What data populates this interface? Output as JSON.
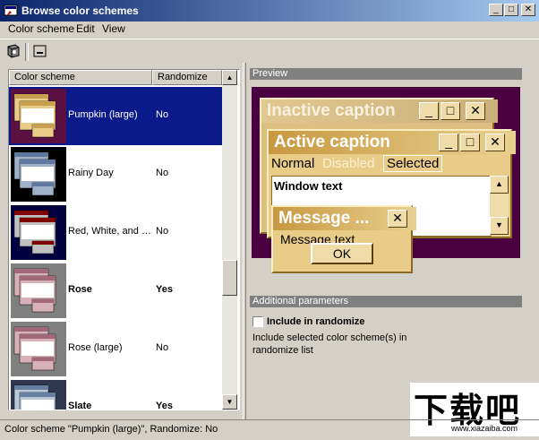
{
  "window": {
    "title": "Browse color schemes",
    "minimize": "_",
    "maximize": "□",
    "close": "✕"
  },
  "menu": [
    "Color scheme",
    "Edit",
    "View"
  ],
  "toolbar": {
    "button1": "color-scheme-icon",
    "button2": "minimize-window-icon"
  },
  "list": {
    "headers": {
      "name": "Color scheme",
      "randomize": "Randomize"
    },
    "rows": [
      {
        "name": "Pumpkin (large)",
        "randomize": "No",
        "selected": true,
        "bold": false,
        "bg": "#5a1040",
        "win": "#e8cc88",
        "cap": "#c8a050"
      },
      {
        "name": "Rainy Day",
        "randomize": "No",
        "selected": false,
        "bold": false,
        "bg": "#000000",
        "win": "#a0b0c8",
        "cap": "#6078a0"
      },
      {
        "name": "Red, White, and Blue (VGA)",
        "randomize": "No",
        "selected": false,
        "bold": false,
        "bg": "#000040",
        "win": "#c0c0c0",
        "cap": "#800000"
      },
      {
        "name": "Rose",
        "randomize": "Yes",
        "selected": false,
        "bold": true,
        "bg": "#808080",
        "win": "#d8b0b8",
        "cap": "#a06878"
      },
      {
        "name": "Rose (large)",
        "randomize": "No",
        "selected": false,
        "bold": false,
        "bg": "#808080",
        "win": "#d8b0b8",
        "cap": "#a06878"
      },
      {
        "name": "Slate",
        "randomize": "Yes",
        "selected": false,
        "bold": true,
        "bg": "#303850",
        "win": "#b8c8d8",
        "cap": "#6880a0"
      }
    ]
  },
  "preview": {
    "section_title": "Preview",
    "inactive_caption": "Inactive caption",
    "active_caption": "Active caption",
    "menu_normal": "Normal",
    "menu_disabled": "Disabled",
    "menu_selected": "Selected",
    "window_text": "Window text",
    "message_caption": "Message ...",
    "message_text": "Message text",
    "ok": "OK"
  },
  "params": {
    "section_title": "Additional parameters",
    "checkbox_label": "Include in randomize",
    "description": "Include selected color scheme(s) in randomize list"
  },
  "status": "Color scheme \"Pumpkin (large)\", Randomize: No",
  "watermark": {
    "text": "下载吧",
    "url": "www.xiazaiba.com"
  }
}
